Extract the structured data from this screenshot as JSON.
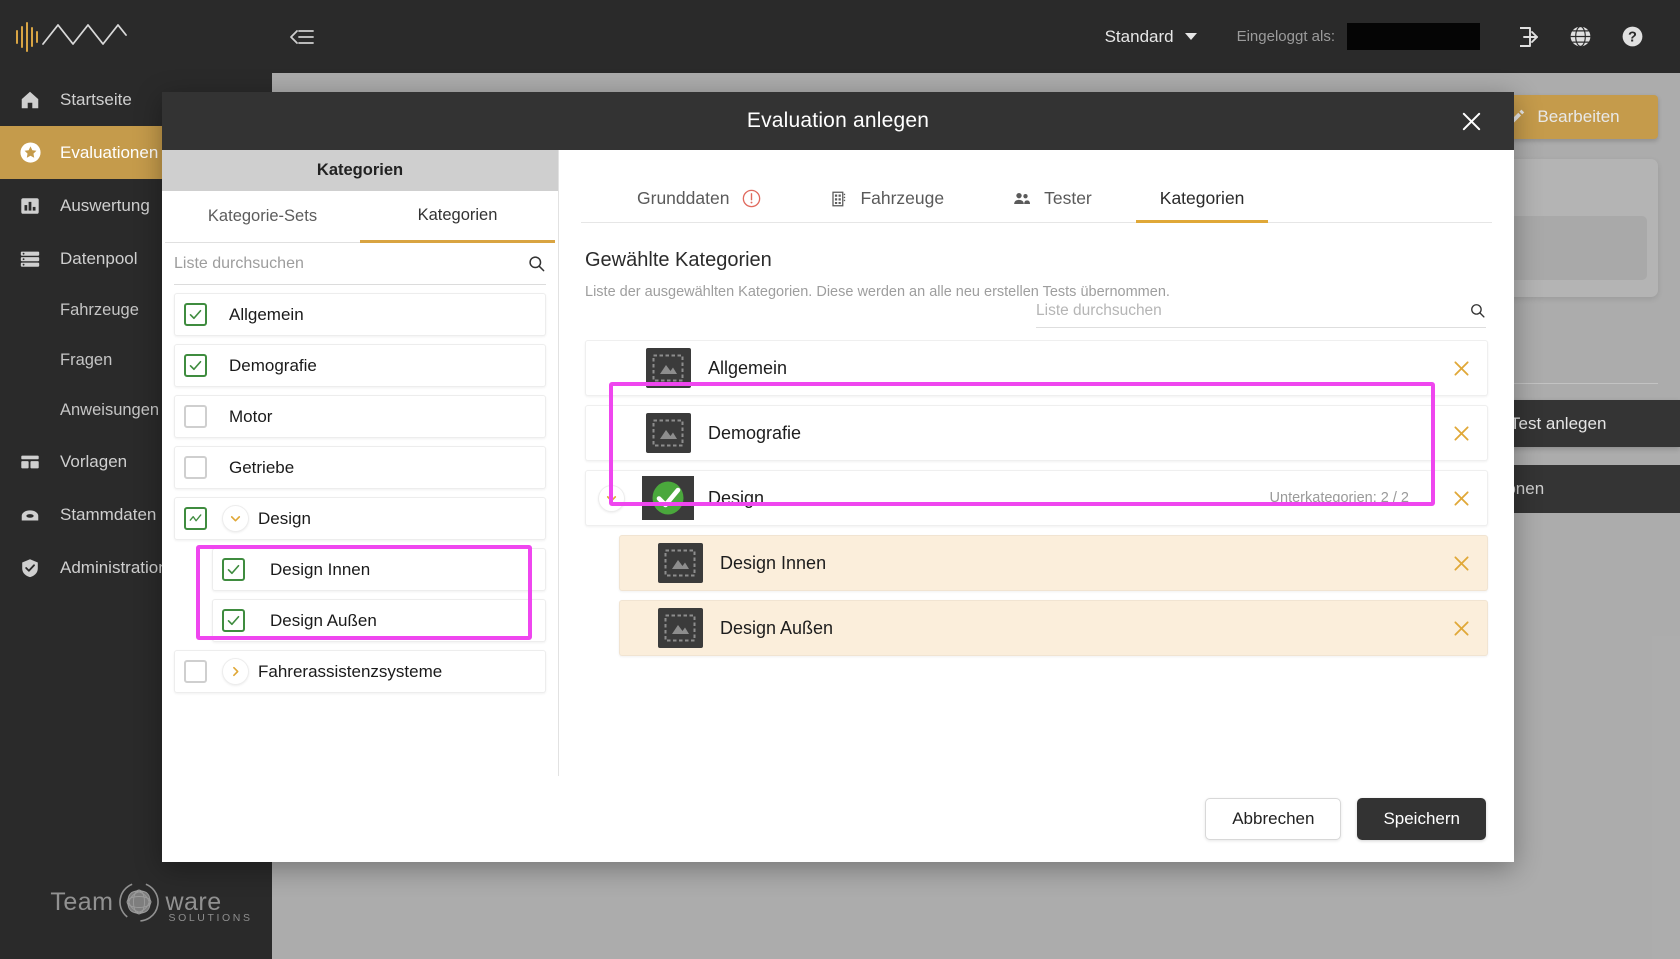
{
  "topbar": {
    "logo_text": "waveform-chevron-logo",
    "collapse_icon": "collapse-sidebar-icon",
    "profile_label": "Standard",
    "logged_in_label": "Eingeloggt als:",
    "logged_in_value": "",
    "logout_icon": "logout-icon",
    "language_icon": "globe-icon",
    "help_icon": "help-icon"
  },
  "sidebar": {
    "items": [
      {
        "label": "Startseite",
        "icon": "home-icon",
        "active": false,
        "sub": false
      },
      {
        "label": "Evaluationen",
        "icon": "star-icon",
        "active": true,
        "sub": false
      },
      {
        "label": "Auswertung",
        "icon": "bar-chart-icon",
        "active": false,
        "sub": false
      },
      {
        "label": "Datenpool",
        "icon": "database-icon",
        "active": false,
        "sub": false
      },
      {
        "label": "Fahrzeuge",
        "icon": "",
        "active": false,
        "sub": true
      },
      {
        "label": "Fragen",
        "icon": "",
        "active": false,
        "sub": true
      },
      {
        "label": "Anweisungen",
        "icon": "",
        "active": false,
        "sub": true
      },
      {
        "label": "Vorlagen",
        "icon": "template-icon",
        "active": false,
        "sub": false
      },
      {
        "label": "Stammdaten",
        "icon": "archive-icon",
        "active": false,
        "sub": false
      },
      {
        "label": "Administration",
        "icon": "shield-check-icon",
        "active": false,
        "sub": false
      }
    ],
    "brand_left": "Team",
    "brand_right": "ware",
    "brand_sub": "SOLUTIONS"
  },
  "background": {
    "edit_button": "Bearbeiten",
    "test_button": "Test anlegen",
    "actions_button": "Aktionen"
  },
  "modal": {
    "title": "Evaluation anlegen",
    "close_icon": "close-icon",
    "left": {
      "header": "Kategorien",
      "tabs": [
        {
          "label": "Kategorie-Sets",
          "active": false
        },
        {
          "label": "Kategorien",
          "active": true
        }
      ],
      "search_placeholder": "Liste durchsuchen",
      "search_value": "",
      "search_icon": "search-icon",
      "rows": [
        {
          "label": "Allgemein",
          "checked": true,
          "indeterminate": false,
          "expander": "none",
          "sub": false,
          "highlighted": false
        },
        {
          "label": "Demografie",
          "checked": true,
          "indeterminate": false,
          "expander": "none",
          "sub": false,
          "highlighted": false
        },
        {
          "label": "Motor",
          "checked": false,
          "indeterminate": false,
          "expander": "none",
          "sub": false,
          "highlighted": false
        },
        {
          "label": "Getriebe",
          "checked": false,
          "indeterminate": false,
          "expander": "none",
          "sub": false,
          "highlighted": false
        },
        {
          "label": "Design",
          "checked": true,
          "indeterminate": true,
          "expander": "down",
          "sub": false,
          "highlighted": false
        },
        {
          "label": "Design Innen",
          "checked": true,
          "indeterminate": false,
          "expander": "none",
          "sub": true,
          "highlighted": true
        },
        {
          "label": "Design Außen",
          "checked": true,
          "indeterminate": false,
          "expander": "none",
          "sub": true,
          "highlighted": true
        },
        {
          "label": "Fahrerassistenzsysteme",
          "checked": false,
          "indeterminate": false,
          "expander": "right",
          "sub": false,
          "highlighted": false
        }
      ]
    },
    "right": {
      "tabs": [
        {
          "label": "Grunddaten",
          "icon": "alert-circle-icon",
          "icon_pos": "after",
          "active": false
        },
        {
          "label": "Fahrzeuge",
          "icon": "car-grid-icon",
          "icon_pos": "before",
          "active": false
        },
        {
          "label": "Tester",
          "icon": "people-icon",
          "icon_pos": "before",
          "active": false
        },
        {
          "label": "Kategorien",
          "icon": "",
          "icon_pos": "none",
          "active": true
        }
      ],
      "section_title": "Gewählte Kategorien",
      "section_subtitle": "Liste der ausgewählten Kategorien. Diese werden an alle neu erstellen Tests übernommen.",
      "search_placeholder": "Liste durchsuchen",
      "search_value": "",
      "search_icon": "search-icon",
      "rows": [
        {
          "label": "Allgemein",
          "thumb": "image-placeholder-icon",
          "expander": "none",
          "sub_count": "",
          "child": false,
          "remove_icon": "remove-icon"
        },
        {
          "label": "Demografie",
          "thumb": "image-placeholder-icon",
          "expander": "none",
          "sub_count": "",
          "child": false,
          "remove_icon": "remove-icon"
        },
        {
          "label": "Design",
          "thumb": "green-check-icon",
          "expander": "down",
          "sub_count": "Unterkategorien: 2 / 2",
          "child": false,
          "remove_icon": "remove-icon"
        },
        {
          "label": "Design Innen",
          "thumb": "image-placeholder-icon",
          "expander": "none",
          "sub_count": "",
          "child": true,
          "remove_icon": "remove-icon"
        },
        {
          "label": "Design Außen",
          "thumb": "image-placeholder-icon",
          "expander": "none",
          "sub_count": "",
          "child": true,
          "remove_icon": "remove-icon"
        }
      ]
    },
    "footer": {
      "cancel_label": "Abbrechen",
      "save_label": "Speichern"
    }
  },
  "colors": {
    "accent_gold": "#c49a48",
    "tab_underline": "#e0a838",
    "highlight_magenta": "#ef46ef",
    "child_row_bg": "#fbeedb",
    "checkbox_green": "#3f8c3f",
    "header_dark": "#333333",
    "sidebar_dark": "#262626"
  }
}
